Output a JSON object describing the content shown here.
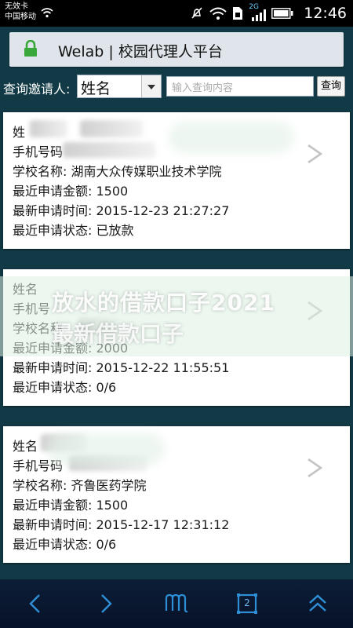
{
  "status_bar": {
    "carrier_line1": "无效卡",
    "carrier_line2": "中国移动",
    "network_type": "2G",
    "time": "12:46"
  },
  "title_bar": {
    "title": "Welab | 校园代理人平台"
  },
  "query": {
    "label": "查询邀请人:",
    "select_value": "姓名",
    "input_placeholder": "输入查询内容",
    "button_label": "查询"
  },
  "cards": [
    {
      "name_label": "姓",
      "phone_label": "手机号码",
      "school": "学校名称: 湖南大众传媒职业技术学院",
      "amount": "最近申请金额: 1500",
      "time": "最新申请时间: 2015-12-23 21:27:27",
      "status": "最近申请状态: 已放款"
    },
    {
      "name_label": "姓名",
      "phone_label": "手机号",
      "school": "学校名称:",
      "amount": "最近申请金额: 2000",
      "time": "最新申请时间: 2015-12-22 11:55:51",
      "status": "最近申请状态: 0/6"
    },
    {
      "name_label": "姓名",
      "phone_label": "手机号码",
      "school": "学校名称: 齐鲁医药学院",
      "amount": "最近申请金额: 1500",
      "time": "最新申请时间: 2015-12-17 12:31:12",
      "status": "最近申请状态: 0/6"
    }
  ],
  "watermark": {
    "line1": "放水的借款口子2021",
    "line2": "最新借款口子"
  },
  "nav": {
    "tabs_count": "2"
  },
  "colors": {
    "page_bg": "#123a46",
    "lock_green": "#3aa73a",
    "nav_bg": "#0d1e37",
    "nav_icon": "#2f8fd6"
  }
}
